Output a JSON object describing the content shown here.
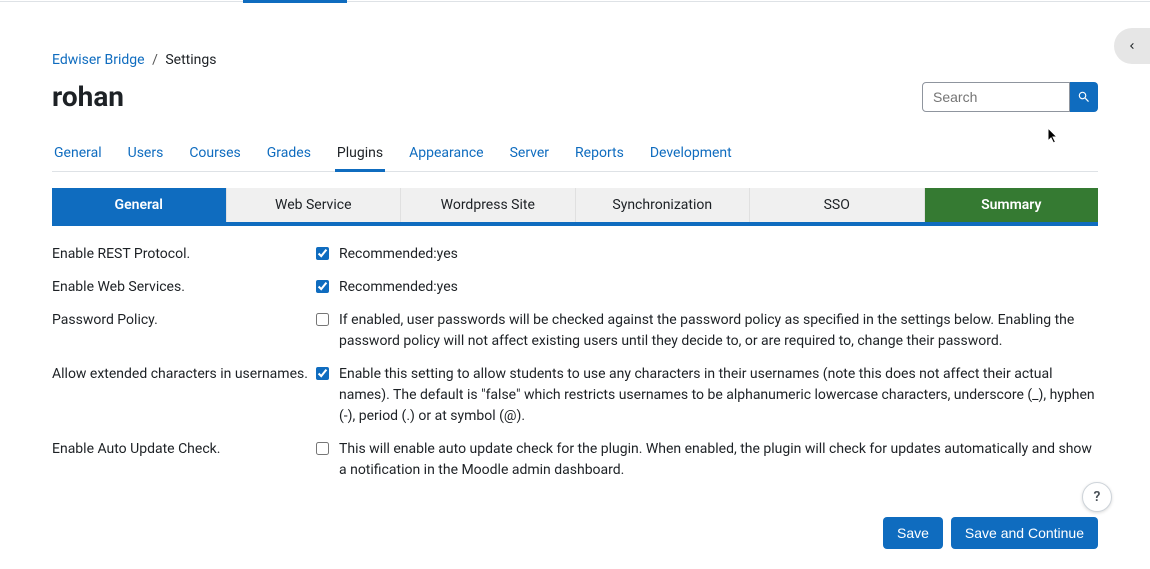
{
  "breadcrumb": {
    "parent": "Edwiser Bridge",
    "current": "Settings"
  },
  "page_title": "rohan",
  "search": {
    "placeholder": "Search"
  },
  "nav": {
    "items": [
      "General",
      "Users",
      "Courses",
      "Grades",
      "Plugins",
      "Appearance",
      "Server",
      "Reports",
      "Development"
    ]
  },
  "subtabs": {
    "items": [
      "General",
      "Web Service",
      "Wordpress Site",
      "Synchronization",
      "SSO",
      "Summary"
    ]
  },
  "settings": [
    {
      "label": "Enable REST Protocol.",
      "checked": true,
      "desc": "Recommended:yes"
    },
    {
      "label": "Enable Web Services.",
      "checked": true,
      "desc": "Recommended:yes"
    },
    {
      "label": "Password Policy.",
      "checked": false,
      "desc": "If enabled, user passwords will be checked against the password policy as specified in the settings below. Enabling the password policy will not affect existing users until they decide to, or are required to, change their password."
    },
    {
      "label": "Allow extended characters in usernames.",
      "checked": true,
      "desc": "Enable this setting to allow students to use any characters in their usernames (note this does not affect their actual names). The default is \"false\" which restricts usernames to be alphanumeric lowercase characters, underscore (_), hyphen (-), period (.) or at symbol (@)."
    },
    {
      "label": "Enable Auto Update Check.",
      "checked": false,
      "desc": "This will enable auto update check for the plugin. When enabled, the plugin will check for updates automatically and show a notification in the Moodle admin dashboard."
    }
  ],
  "actions": {
    "save": "Save",
    "save_continue": "Save and Continue"
  },
  "help": "?"
}
